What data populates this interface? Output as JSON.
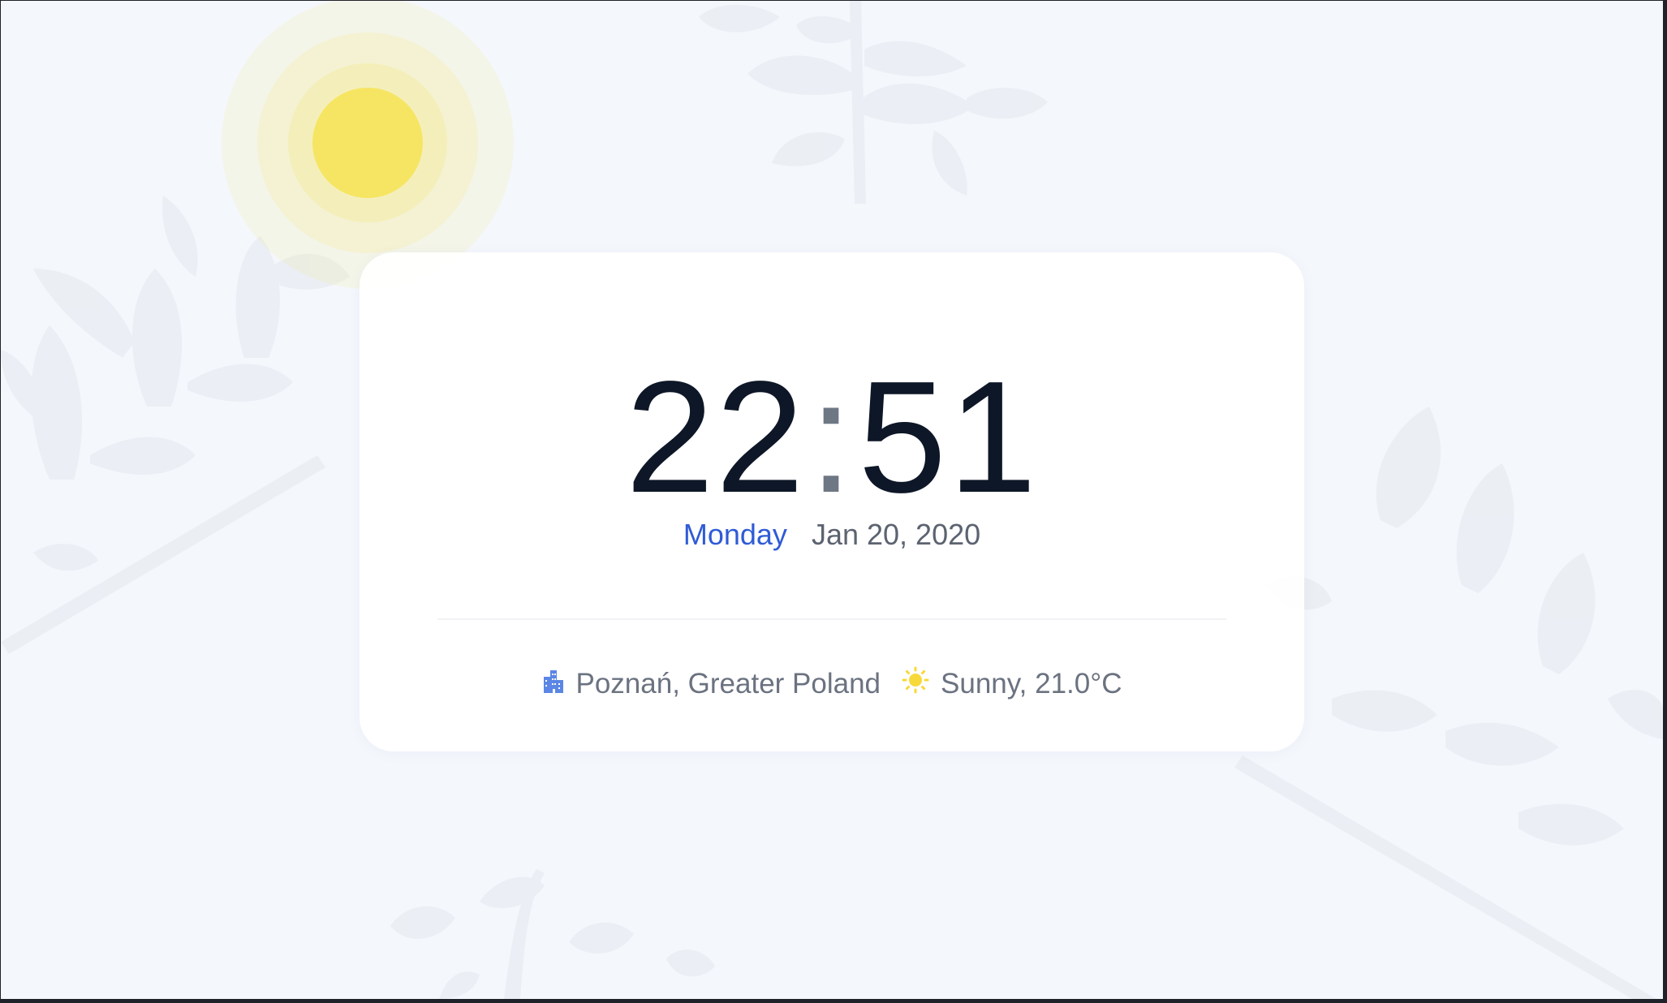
{
  "clock": {
    "hours": "22",
    "separator": ":",
    "minutes": "51"
  },
  "date": {
    "weekday": "Monday",
    "date_text": "Jan 20, 2020"
  },
  "location": {
    "icon": "city-buildings-icon",
    "text": "Poznań, Greater Poland"
  },
  "weather": {
    "icon": "sun-icon",
    "text": "Sunny, 21.0°C"
  },
  "colors": {
    "background": "#f4f7fc",
    "card": "#ffffff",
    "time": "#0e1727",
    "weekday": "#2f5bd6",
    "muted_text": "#6b7280",
    "sun": "#f6e562",
    "city_icon": "#5b86e5"
  }
}
